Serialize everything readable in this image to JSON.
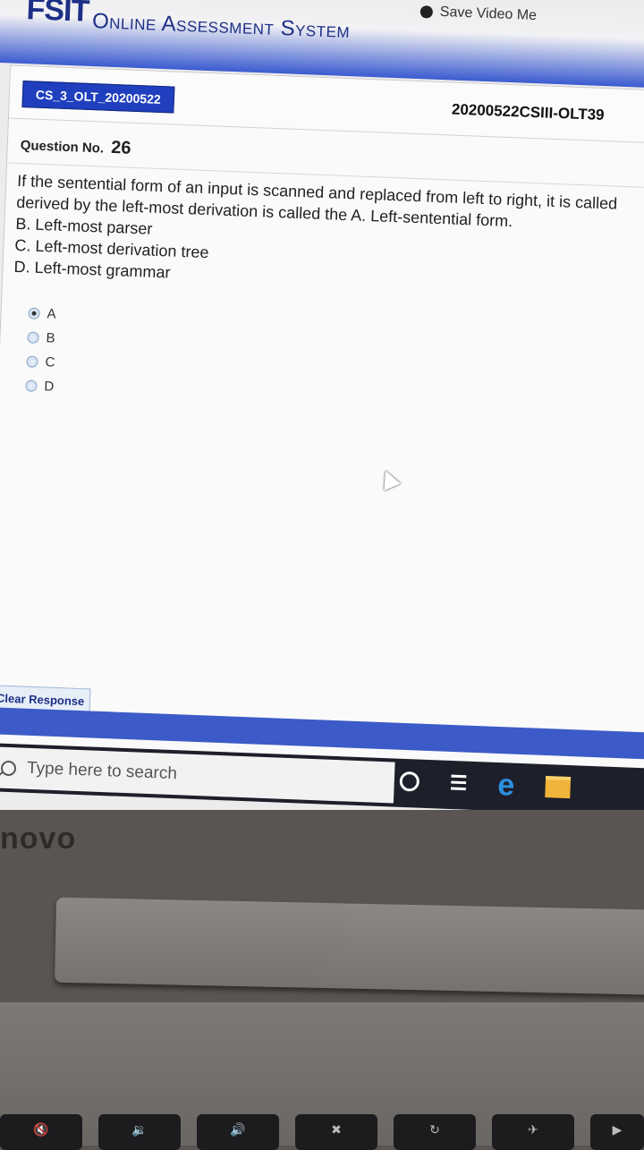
{
  "header": {
    "logo": "FSIT",
    "app_title": "Online Assessment System",
    "save_video": "Save Video Me"
  },
  "exam": {
    "section_tab": "CS_3_OLT_20200522",
    "paper_code": "20200522CSIII-OLT39"
  },
  "question": {
    "number_label": "Question No.",
    "number": "26",
    "text_line1": "If the sentential form of an input is scanned and replaced from left to right, it is called",
    "text_line2": "derived by the left-most derivation is called the A. Left-sentential form.",
    "options": [
      "B. Left-most parser",
      "C. Left-most derivation tree",
      "D. Left-most grammar"
    ]
  },
  "answers": {
    "selected": "A",
    "choices": [
      "A",
      "B",
      "C",
      "D"
    ]
  },
  "actions": {
    "clear_response": "Clear Response"
  },
  "taskbar": {
    "search_placeholder": "Type here to search"
  },
  "laptop": {
    "brand": "novo"
  }
}
